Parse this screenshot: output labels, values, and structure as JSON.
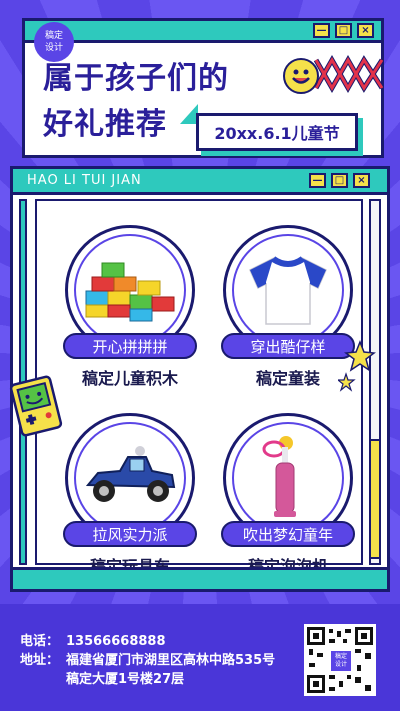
{
  "brand": {
    "logo_line1": "稿定",
    "logo_line2": "设计"
  },
  "title": {
    "line1": "属于孩子们的",
    "line2": "好礼推荐",
    "tag": "20xx.6.1儿童节"
  },
  "main_window": {
    "bar_text": "HAO LI TUI JIAN"
  },
  "window_controls": {
    "minimize": "—",
    "maximize": "□",
    "close": "×"
  },
  "products": [
    {
      "tagline": "开心拼拼拼",
      "name": "稿定儿童积木",
      "icon": "building-blocks-icon"
    },
    {
      "tagline": "穿出酷仔样",
      "name": "稿定童装",
      "icon": "tshirt-icon"
    },
    {
      "tagline": "拉风实力派",
      "name": "稿定玩具车",
      "icon": "toy-car-icon"
    },
    {
      "tagline": "吹出梦幻童年",
      "name": "稿定泡泡机",
      "icon": "bubble-wand-icon"
    }
  ],
  "footer": {
    "phone_label": "电话：",
    "phone": "13566668888",
    "address_label": "地址：",
    "address_line1": "福建省厦门市湖里区高林中路535号",
    "address_line2": "稿定大厦1号楼27层",
    "qr_logo_line1": "稿定",
    "qr_logo_line2": "设计"
  },
  "colors": {
    "background": "#5a45e6",
    "accent_teal": "#2ec9bd",
    "accent_yellow": "#f5e14a",
    "outline": "#1a1a6e",
    "title_text": "#2a1f9a"
  }
}
